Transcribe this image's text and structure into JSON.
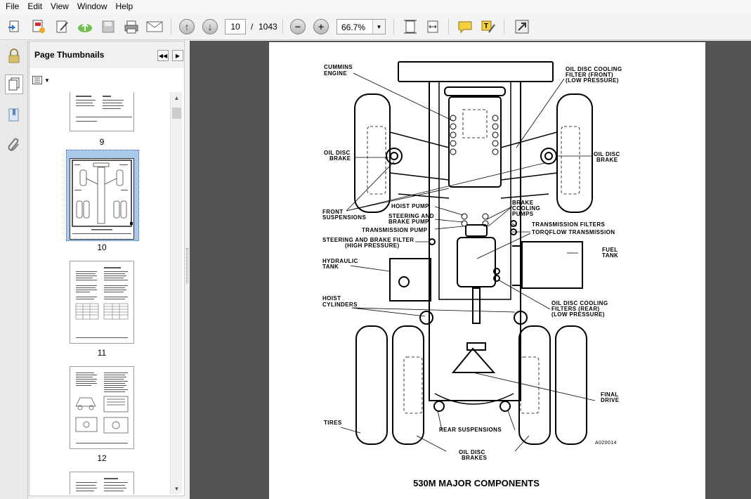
{
  "menu": [
    "File",
    "Edit",
    "View",
    "Window",
    "Help"
  ],
  "toolbar": {
    "current_page": "10",
    "page_separator": "/",
    "total_pages": "1043",
    "zoom": "66.7%"
  },
  "thumbnails_panel": {
    "title": "Page Thumbnails",
    "pages": [
      "9",
      "10",
      "11",
      "12"
    ],
    "selected_page": "10"
  },
  "document": {
    "caption": "530M MAJOR COMPONENTS",
    "figure_id": "A020014",
    "labels": {
      "cummins_engine_1": "CUMMINS",
      "cummins_engine_2": "ENGINE",
      "oil_disc_cooling_front_1": "OIL DISC COOLING",
      "oil_disc_cooling_front_2": "FILTER (FRONT)",
      "oil_disc_cooling_front_3": "(LOW PRESSURE)",
      "oil_disc_brake_left_1": "OIL DISC",
      "oil_disc_brake_left_2": "BRAKE",
      "oil_disc_brake_right_1": "OIL DISC",
      "oil_disc_brake_right_2": "BRAKE",
      "hoist_pump": "HOIST PUMP",
      "brake_cooling_1": "BRAKE",
      "brake_cooling_2": "COOLING",
      "brake_cooling_3": "PUMPS",
      "front_suspensions_1": "FRONT",
      "front_suspensions_2": "SUSPENSIONS",
      "steering_brake_pump_1": "STEERING AND",
      "steering_brake_pump_2": "BRAKE PUMP",
      "transmission_filters": "TRANSMISSION FILTERS",
      "transmission_pump": "TRANSMISSION PUMP",
      "torqflow_transmission": "TORQFLOW TRANSMISSION",
      "steering_brake_filter_1": "STEERING AND BRAKE FILTER",
      "steering_brake_filter_2": "(HIGH PRESSURE)",
      "fuel_tank_1": "FUEL",
      "fuel_tank_2": "TANK",
      "hydraulic_tank_1": "HYDRAULIC",
      "hydraulic_tank_2": "TANK",
      "hoist_cylinders_1": "HOIST",
      "hoist_cylinders_2": "CYLINDERS",
      "oil_disc_cooling_rear_1": "OIL DISC COOLING",
      "oil_disc_cooling_rear_2": "FILTERS (REAR)",
      "oil_disc_cooling_rear_3": "(LOW PRESSURE)",
      "final_drive_1": "FINAL",
      "final_drive_2": "DRIVE",
      "tires": "TIRES",
      "rear_suspensions": "REAR SUSPENSIONS",
      "oil_disc_brakes_1": "OIL DISC",
      "oil_disc_brakes_2": "BRAKES"
    }
  },
  "icons": [
    "open-file-icon",
    "create-pdf-icon",
    "edit-icon",
    "upload-cloud-icon",
    "save-icon",
    "print-icon",
    "email-icon",
    "page-up-icon",
    "page-down-icon",
    "zoom-out-icon",
    "zoom-in-icon",
    "fit-page-icon",
    "fit-width-icon",
    "comment-icon",
    "highlight-icon",
    "fullscreen-icon",
    "lock-icon",
    "pages-icon",
    "bookmark-icon",
    "attachment-icon"
  ]
}
